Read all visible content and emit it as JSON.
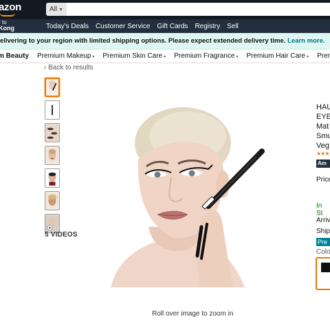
{
  "header": {
    "logo_text": "azon",
    "deliver_line1": "r to",
    "deliver_line2": "Kong",
    "search_category": "All",
    "search_placeholder": ""
  },
  "nav": {
    "links": [
      "Today's Deals",
      "Customer Service",
      "Gift Cards",
      "Registry",
      "Sell"
    ]
  },
  "notice": {
    "text": "elivering to your region with limited shipping options. Please expect extended delivery time.",
    "link": "Learn more."
  },
  "category_nav": {
    "first": "m Beauty",
    "items": [
      "Premium Makeup",
      "Premium Skin Care",
      "Premium Fragrance",
      "Premium Hair Care",
      "Premium M"
    ]
  },
  "breadcrumb": {
    "back": "‹ Back to results"
  },
  "gallery": {
    "videos_label": "5 VIDEOS",
    "zoom_hint": "Roll over image to zoom in"
  },
  "product": {
    "title_lines": [
      "HAU",
      "EYE",
      "Mat",
      "Smu",
      "Veg"
    ],
    "price_label": "Price",
    "stock": "In St",
    "arrives": "Arriv",
    "ships": "Ship",
    "badge_dark": "Am",
    "badge_teal": "Pre",
    "color_label": "Colo"
  },
  "colors": {
    "header_bg": "#131921",
    "nav_bg": "#232f3e",
    "notice_bg": "#dff6f3",
    "link": "#007185",
    "accent": "#e77600",
    "stock_green": "#007600",
    "star": "#de7921"
  }
}
